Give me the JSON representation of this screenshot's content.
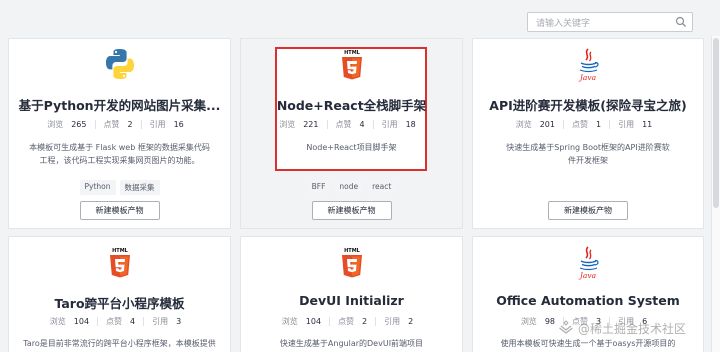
{
  "search": {
    "placeholder": "请输入关键字"
  },
  "cards": [
    {
      "title": "基于Python开发的网站图片采集...",
      "logo": "python-logo",
      "stats": {
        "views_label": "浏览",
        "views": "265",
        "likes_label": "点赞",
        "likes": "2",
        "refs_label": "引用",
        "refs": "16"
      },
      "desc": "本模板可生成基于 Flask web 框架的数据采集代码工程，该代码工程实现采集网页图片的功能。",
      "tags": [
        "Python",
        "数据采集"
      ],
      "button": "新建模板产物"
    },
    {
      "title": "Node+React全栈脚手架",
      "logo": "html5-logo",
      "logo_text": "HTML",
      "stats": {
        "views_label": "浏览",
        "views": "221",
        "likes_label": "点赞",
        "likes": "4",
        "refs_label": "引用",
        "refs": "18"
      },
      "desc": "Node+React项目脚手架",
      "tags": [
        "BFF",
        "node",
        "react"
      ],
      "button": "新建模板产物"
    },
    {
      "title": "API进阶赛开发模板(探险寻宝之旅)",
      "logo": "java-logo",
      "logo_text": "Java",
      "stats": {
        "views_label": "浏览",
        "views": "201",
        "likes_label": "点赞",
        "likes": "1",
        "refs_label": "引用",
        "refs": "11"
      },
      "desc": "快速生成基于Spring Boot框架的API进阶赛软件开发框架",
      "tags": [],
      "button": "新建模板产物"
    },
    {
      "title": "Taro跨平台小程序模板",
      "logo": "html5-logo",
      "logo_text": "HTML",
      "stats": {
        "views_label": "浏览",
        "views": "104",
        "likes_label": "点赞",
        "likes": "4",
        "refs_label": "引用",
        "refs": "3"
      },
      "desc": "Taro是目前非常流行的跨平台小程序框架，本模板提供",
      "tags": [],
      "button": ""
    },
    {
      "title": "DevUI Initializr",
      "logo": "html5-logo",
      "logo_text": "HTML",
      "stats": {
        "views_label": "浏览",
        "views": "104",
        "likes_label": "点赞",
        "likes": "2",
        "refs_label": "引用",
        "refs": "2"
      },
      "desc": "快速生成基于Angular的DevUI前端项目",
      "tags": [],
      "button": ""
    },
    {
      "title": "Office Automation System",
      "logo": "java-logo",
      "logo_text": "Java",
      "stats": {
        "views_label": "浏览",
        "views": "98",
        "likes_label": "点赞",
        "likes": "3",
        "refs_label": "引用",
        "refs": "6"
      },
      "desc": "使用本模板可快速生成一个基于oasys开源项目的",
      "tags": [],
      "button": ""
    }
  ],
  "watermark": "@稀土掘金技术社区",
  "colors": {
    "accent_red": "#dc2f2f",
    "html5_orange": "#e44d26",
    "python_blue": "#3776ab",
    "python_yellow": "#ffd43b"
  }
}
